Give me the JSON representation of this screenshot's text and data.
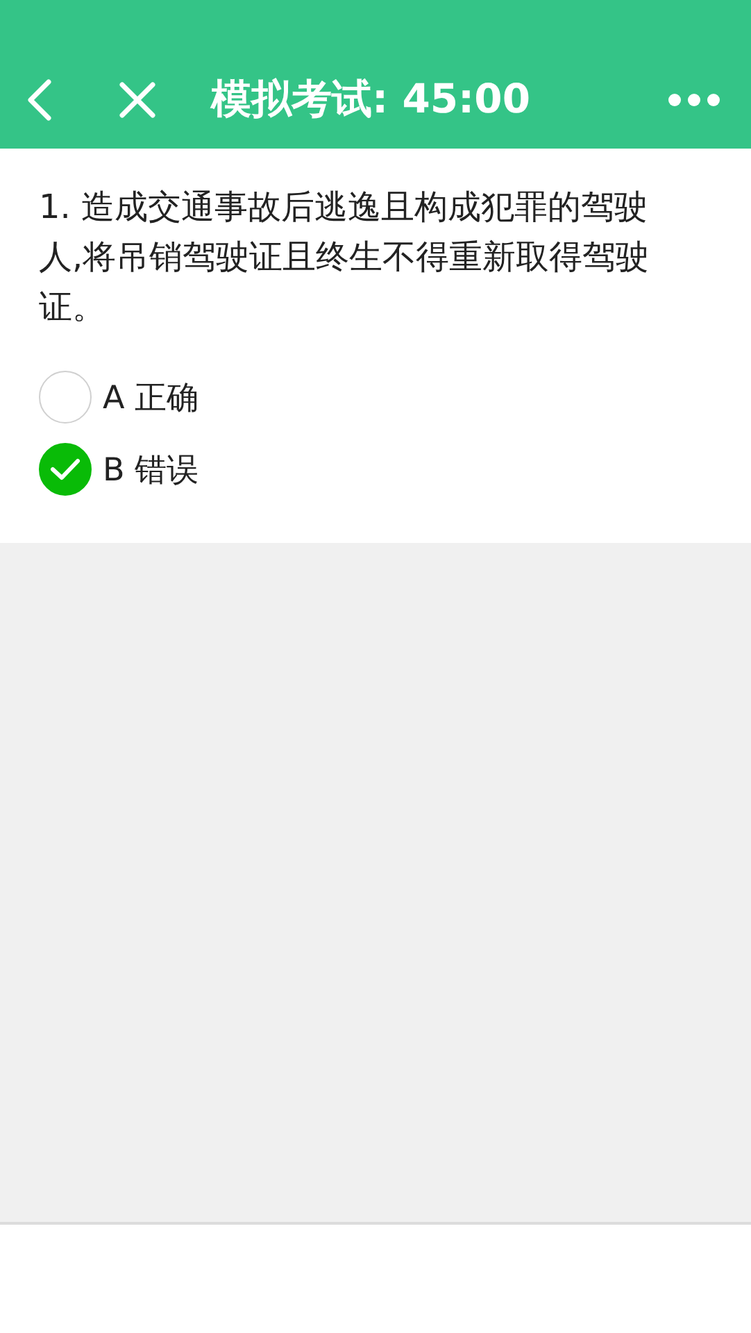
{
  "header": {
    "title": "模拟考试: 45:00"
  },
  "question": {
    "text": "1. 造成交通事故后逃逸且构成犯罪的驾驶人,将吊销驾驶证且终生不得重新取得驾驶证。"
  },
  "options": [
    {
      "label": "A 正确",
      "selected": false
    },
    {
      "label": "B 错误",
      "selected": true
    }
  ]
}
